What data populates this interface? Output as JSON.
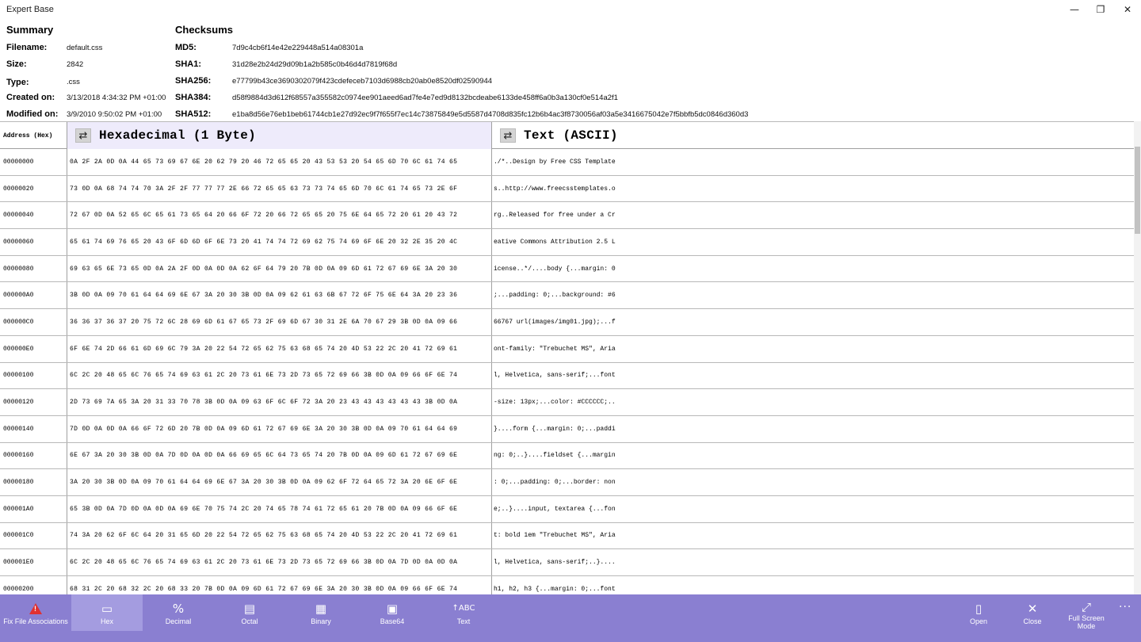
{
  "window": {
    "title": "Expert Base",
    "minimize": "—",
    "maximize": "❐",
    "close": "✕"
  },
  "summary": {
    "heading": "Summary",
    "fields": [
      {
        "label": "Filename:",
        "value": "default.css"
      },
      {
        "label": "Size:",
        "value": "2842"
      },
      {
        "label": "Type:",
        "value": ".css"
      },
      {
        "label": "Created on:",
        "value": "3/13/2018 4:34:32 PM +01:00"
      },
      {
        "label": "Modified on:",
        "value": "3/9/2010 9:50:02 PM +01:00"
      }
    ]
  },
  "checksums": {
    "heading": "Checksums",
    "fields": [
      {
        "label": "MD5:",
        "value": "7d9c4cb6f14e42e229448a514a08301a"
      },
      {
        "label": "SHA1:",
        "value": "31d28e2b24d29d09b1a2b585c0b46d4d7819f68d"
      },
      {
        "label": "SHA256:",
        "value": "e77799b43ce3690302079f423cdefeceb7103d6988cb20ab0e8520df02590944"
      },
      {
        "label": "SHA384:",
        "value": "d58f9884d3d612f68557a355582c0974ee901aeed6ad7fe4e7ed9d8132bcdeabe6133de458ff6a0b3a130cf0e514a2f1"
      },
      {
        "label": "SHA512:",
        "value": "e1ba8d56e76eb1beb61744cb1e27d92ec9f7f655f7ec14c73875849e5d5587d4708d835fc12b6b4ac3f8730056af03a5e3416675042e7f5bbfb5dc0846d360d3"
      }
    ]
  },
  "grid": {
    "address_header": "Address (Hex)",
    "hex_header": "Hexadecimal (1 Byte)",
    "text_header": "Text (ASCII)",
    "swap_icon": "⇄",
    "rows": [
      {
        "addr": "00000000",
        "hex": "0A 2F 2A 0D 0A 44 65 73 69 67 6E 20 62 79 20 46 72 65 65 20 43 53 53 20 54 65 6D 70 6C 61 74 65",
        "text": "./*..Design by Free CSS Template"
      },
      {
        "addr": "00000020",
        "hex": "73 0D 0A 68 74 74 70 3A 2F 2F 77 77 77 2E 66 72 65 65 63 73 73 74 65 6D 70 6C 61 74 65 73 2E 6F",
        "text": "s..http://www.freecsstemplates.o"
      },
      {
        "addr": "00000040",
        "hex": "72 67 0D 0A 52 65 6C 65 61 73 65 64 20 66 6F 72 20 66 72 65 65 20 75 6E 64 65 72 20 61 20 43 72",
        "text": "rg..Released for free under a Cr"
      },
      {
        "addr": "00000060",
        "hex": "65 61 74 69 76 65 20 43 6F 6D 6D 6F 6E 73 20 41 74 74 72 69 62 75 74 69 6F 6E 20 32 2E 35 20 4C",
        "text": "eative Commons Attribution 2.5 L"
      },
      {
        "addr": "00000080",
        "hex": "69 63 65 6E 73 65 0D 0A 2A 2F 0D 0A 0D 0A 62 6F 64 79 20 7B 0D 0A 09 6D 61 72 67 69 6E 3A 20 30",
        "text": "icense..*/....body {...margin: 0"
      },
      {
        "addr": "000000A0",
        "hex": "3B 0D 0A 09 70 61 64 64 69 6E 67 3A 20 30 3B 0D 0A 09 62 61 63 6B 67 72 6F 75 6E 64 3A 20 23 36",
        "text": ";...padding: 0;...background: #6"
      },
      {
        "addr": "000000C0",
        "hex": "36 36 37 36 37 20 75 72 6C 28 69 6D 61 67 65 73 2F 69 6D 67 30 31 2E 6A 70 67 29 3B 0D 0A 09 66",
        "text": "66767 url(images/img01.jpg);...f"
      },
      {
        "addr": "000000E0",
        "hex": "6F 6E 74 2D 66 61 6D 69 6C 79 3A 20 22 54 72 65 62 75 63 68 65 74 20 4D 53 22 2C 20 41 72 69 61",
        "text": "ont-family: \"Trebuchet MS\", Aria"
      },
      {
        "addr": "00000100",
        "hex": "6C 2C 20 48 65 6C 76 65 74 69 63 61 2C 20 73 61 6E 73 2D 73 65 72 69 66 3B 0D 0A 09 66 6F 6E 74",
        "text": "l, Helvetica, sans-serif;...font"
      },
      {
        "addr": "00000120",
        "hex": "2D 73 69 7A 65 3A 20 31 33 70 78 3B 0D 0A 09 63 6F 6C 6F 72 3A 20 23 43 43 43 43 43 43 3B 0D 0A",
        "text": "-size: 13px;...color: #CCCCCC;.."
      },
      {
        "addr": "00000140",
        "hex": "7D 0D 0A 0D 0A 66 6F 72 6D 20 7B 0D 0A 09 6D 61 72 67 69 6E 3A 20 30 3B 0D 0A 09 70 61 64 64 69",
        "text": "}....form {...margin: 0;...paddi"
      },
      {
        "addr": "00000160",
        "hex": "6E 67 3A 20 30 3B 0D 0A 7D 0D 0A 0D 0A 66 69 65 6C 64 73 65 74 20 7B 0D 0A 09 6D 61 72 67 69 6E",
        "text": "ng: 0;..}....fieldset {...margin"
      },
      {
        "addr": "00000180",
        "hex": "3A 20 30 3B 0D 0A 09 70 61 64 64 69 6E 67 3A 20 30 3B 0D 0A 09 62 6F 72 64 65 72 3A 20 6E 6F 6E",
        "text": ": 0;...padding: 0;...border: non"
      },
      {
        "addr": "000001A0",
        "hex": "65 3B 0D 0A 7D 0D 0A 0D 0A 69 6E 70 75 74 2C 20 74 65 78 74 61 72 65 61 20 7B 0D 0A 09 66 6F 6E",
        "text": "e;..}....input, textarea {...fon"
      },
      {
        "addr": "000001C0",
        "hex": "74 3A 20 62 6F 6C 64 20 31 65 6D 20 22 54 72 65 62 75 63 68 65 74 20 4D 53 22 2C 20 41 72 69 61",
        "text": "t: bold 1em \"Trebuchet MS\", Aria"
      },
      {
        "addr": "000001E0",
        "hex": "6C 2C 20 48 65 6C 76 65 74 69 63 61 2C 20 73 61 6E 73 2D 73 65 72 69 66 3B 0D 0A 7D 0D 0A 0D 0A",
        "text": "l, Helvetica, sans-serif;..}...."
      },
      {
        "addr": "00000200",
        "hex": "68 31 2C 20 68 32 2C 20 68 33 20 7B 0D 0A 09 6D 61 72 67 69 6E 3A 20 30 3B 0D 0A 09 66 6F 6E 74",
        "text": "h1, h2, h3 {...margin: 0;...font"
      }
    ]
  },
  "commands": {
    "fix": {
      "label": "Fix File Associations"
    },
    "hex": {
      "label": "Hex",
      "icon": "▭"
    },
    "decimal": {
      "label": "Decimal",
      "icon": "%"
    },
    "octal": {
      "label": "Octal",
      "icon": "▤"
    },
    "binary": {
      "label": "Binary",
      "icon": "▦"
    },
    "base64": {
      "label": "Base64",
      "icon": "▣"
    },
    "text": {
      "label": "Text",
      "icon": "↑ABC"
    },
    "open": {
      "label": "Open",
      "icon": "▯"
    },
    "close": {
      "label": "Close",
      "icon": "✕"
    },
    "fullscreen": {
      "label": "Full Screen Mode",
      "icon": "⤢"
    },
    "more": "···"
  },
  "colors": {
    "accent": "#8a7fd1",
    "active": "#a49ce0",
    "hex_header_bg": "#eeebfb",
    "warning": "#e03030"
  }
}
